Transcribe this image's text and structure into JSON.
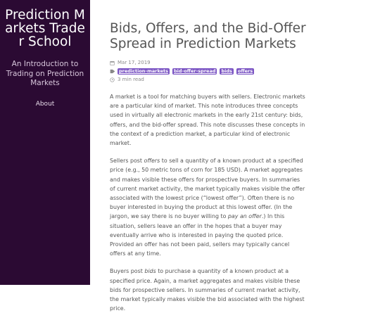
{
  "sidebar": {
    "title": "Prediction Markets Trader School",
    "description": "An Introduction to Trading on Prediction Markets",
    "nav_about": "About"
  },
  "post": {
    "title": "Bids, Offers, and the Bid-Offer Spread in Prediction Markets",
    "date": "Mar 17, 2019",
    "tags": [
      "prediction-markets",
      "bid-offer-spread",
      "bids",
      "offers"
    ],
    "read_time": "3 min read",
    "p1": "A market is a tool for matching buyers with sellers. Electronic markets are a particular kind of market. This note introduces three concepts used in virtually all electronic markets in the early 21st century: bids, offers, and the bid-offer spread. This note discusses these concepts in the context of a prediction market, a particular kind of electronic market.",
    "p2_a": "Sellers post ",
    "p2_em1": "offers",
    "p2_b": " to sell a quantity of a known product at a specified price (e.g., 50 metric tons of corn for 185 USD). A market aggregates and makes visible these offers for prospective buyers. In summaries of current market activity, the market typically makes visible the offer associated with the lowest price (“lowest offer”). Often there is no buyer interested in buying the product at this lowest offer. (In the jargon, we say there is no buyer willing to ",
    "p2_em2": "pay an offer",
    "p2_c": ".) In this situation, sellers leave an offer in the hopes that a buyer may eventually arrive who is interested in paying the quoted price. Provided an offer has not been paid, sellers may typically cancel offers at any time.",
    "p3_a": "Buyers post ",
    "p3_em": "bids",
    "p3_b": " to purchase a quantity of a known product at a specified price. Again, a market aggregates and makes visible these bids for prospective sellers. In summaries of current market activity, the market typically makes visible the bid associated with the highest price."
  },
  "icons": {
    "date": "calendar-icon",
    "tags": "tag-icon",
    "read_time": "clock-icon"
  },
  "colors": {
    "sidebar_bg": "#2b0a33",
    "tag_bg": "#7c56c4",
    "text": "#555555"
  }
}
